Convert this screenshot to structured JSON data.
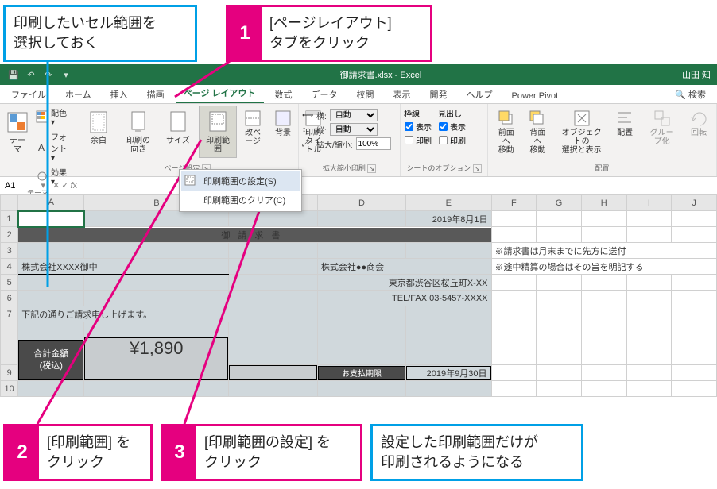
{
  "callouts": {
    "sel_hint": "印刷したいセル範囲を\n選択しておく",
    "step1": "[ページレイアウト]\nタブをクリック",
    "step2": "[印刷範囲] を\nクリック",
    "step3": "[印刷範囲の設定] を\nクリック",
    "result": "設定した印刷範囲だけが\n印刷されるようになる"
  },
  "titlebar": {
    "title": "御請求書.xlsx - Excel",
    "user": "山田 知"
  },
  "tabs": [
    "ファイル",
    "ホーム",
    "挿入",
    "描画",
    "ページ レイアウト",
    "数式",
    "データ",
    "校閲",
    "表示",
    "開発",
    "ヘルプ",
    "Power Pivot"
  ],
  "search_label": "検索",
  "ribbon": {
    "themes": {
      "label": "テーマ",
      "colors": "配色 ▾",
      "fonts": "フォント ▾",
      "effects": "効果 ▾"
    },
    "page_setup": {
      "label": "ページ設定",
      "margins": "余白",
      "orientation": "印刷の\n向き",
      "size": "サイズ",
      "print_area": "印刷範囲",
      "breaks": "改ページ",
      "background": "背景",
      "titles": "印刷\nタイトル"
    },
    "scale": {
      "label": "拡大縮小印刷",
      "width_lbl": "横:",
      "height_lbl": "縦:",
      "width_val": "自動",
      "height_val": "自動",
      "scale_lbl": "拡大/縮小:",
      "scale_val": "100%"
    },
    "sheet_opts": {
      "label": "シートのオプション",
      "gridlines": "枠線",
      "view": "表示",
      "print": "印刷",
      "headings": "見出し"
    },
    "arrange": {
      "label": "配置",
      "forward": "前面へ\n移動",
      "backward": "背面へ\n移動",
      "select": "オブジェクトの\n選択と表示",
      "align": "配置",
      "group": "グループ化",
      "rotate": "回転"
    }
  },
  "dropdown": {
    "set": "印刷範囲の設定(S)",
    "clear": "印刷範囲のクリア(C)"
  },
  "namebox": "A1",
  "columns": [
    "A",
    "B",
    "C",
    "D",
    "E",
    "F",
    "G",
    "H",
    "I",
    "J"
  ],
  "rows": [
    "1",
    "2",
    "3",
    "4",
    "5",
    "6",
    "7",
    "",
    "9",
    "10"
  ],
  "cells": {
    "date1": "2019年8月1日",
    "doc_title": "御請求書",
    "company_to": "株式会社XXXX御中",
    "company_from": "株式会社●●商会",
    "address": "東京都渋谷区桜丘町X-XX",
    "telfax": "TEL/FAX 03-5457-XXXX",
    "note": "下記の通りご請求申し上げます。",
    "total_lbl1": "合計金額",
    "total_lbl2": "(税込)",
    "total_amount": "¥1,890",
    "pay_lbl": "お支払期限",
    "pay_date": "2019年9月30日",
    "note_f3": "※請求書は月末までに先方に送付",
    "note_f4": "※途中精算の場合はその旨を明記する"
  }
}
